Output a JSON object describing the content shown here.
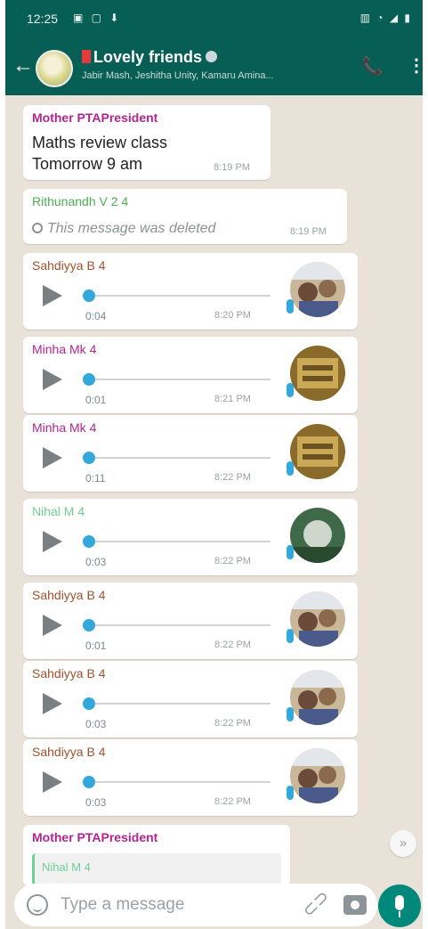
{
  "status_bar": {
    "time": "12:25",
    "left_icons": "▣ ▢ ⬇",
    "right_icons": "▥ ◔ ◢ ▮"
  },
  "header": {
    "group_name": "Lovely friends",
    "members": "Jabir Mash, Jeshitha Unity, Kamaru Amina..."
  },
  "messages": {
    "m1": {
      "sender": "Mother PTAPresident",
      "sender_color": "#b2258f",
      "lines": [
        "Maths review  class",
        "Tomorrow 9 am"
      ],
      "time": "8:19 PM"
    },
    "m2": {
      "sender": "Rithunandh V 2 4",
      "sender_color": "#4caf50",
      "text": "This message was deleted",
      "time": "8:19 PM"
    },
    "voices": [
      {
        "sender": "Sahdiyya B 4",
        "sender_color": "#a0522d",
        "duration": "0:04",
        "time": "8:20 PM"
      },
      {
        "sender": "Minha Mk 4",
        "sender_color": "#b2258f",
        "duration": "0:01",
        "time": "8:21 PM"
      },
      {
        "sender": "Minha Mk 4",
        "sender_color": "#b2258f",
        "duration": "0:11",
        "time": "8:22 PM"
      },
      {
        "sender": "Nihal M 4",
        "sender_color": "#6fcf97",
        "duration": "0:03",
        "time": "8:22 PM"
      },
      {
        "sender": "Sahdiyya B 4",
        "sender_color": "#a0522d",
        "duration": "0:01",
        "time": "8:22 PM"
      },
      {
        "sender": "Sahdiyya B 4",
        "sender_color": "#a0522d",
        "duration": "0:03",
        "time": "8:22 PM"
      },
      {
        "sender": "Sahdiyya B 4",
        "sender_color": "#a0522d",
        "duration": "0:03",
        "time": "8:22 PM"
      }
    ],
    "m_last": {
      "sender": "Mother PTAPresident",
      "sender_color": "#b2258f",
      "quote_sender": "Nihal M 4"
    }
  },
  "composer": {
    "placeholder": "Type a message"
  },
  "colors": {
    "header_bg": "#075e54",
    "chat_bg": "#e9e2d8",
    "accent": "#00897b",
    "voice_blue": "#33a9db"
  },
  "icons": [
    "back-arrow-icon",
    "add-call-icon",
    "menu-dots-icon",
    "deleted-icon",
    "play-icon",
    "mic-icon",
    "emoji-icon",
    "attach-icon",
    "camera-icon",
    "chevron-down-icon"
  ]
}
